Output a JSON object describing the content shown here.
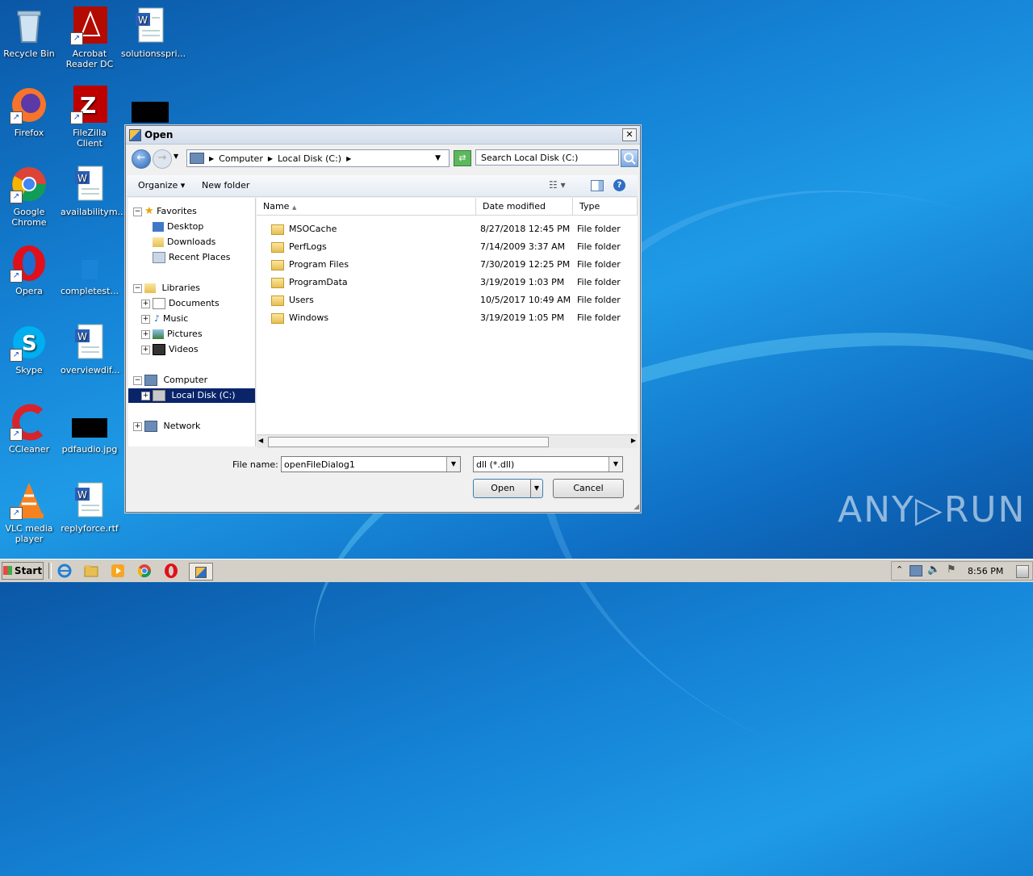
{
  "desktop": {
    "icons": [
      {
        "label": "Recycle Bin"
      },
      {
        "label": "Acrobat Reader DC"
      },
      {
        "label": "solutionsspri..."
      },
      {
        "label": "Firefox"
      },
      {
        "label": "FileZilla Client"
      },
      {
        "label": "Google Chrome"
      },
      {
        "label": "availabilitym..."
      },
      {
        "label": "Opera"
      },
      {
        "label": "completest..."
      },
      {
        "label": "Skype"
      },
      {
        "label": "overviewdif..."
      },
      {
        "label": "CCleaner"
      },
      {
        "label": "pdfaudio.jpg"
      },
      {
        "label": "VLC media player"
      },
      {
        "label": "replyforce.rtf"
      }
    ]
  },
  "dialog": {
    "title": "Open",
    "breadcrumb": [
      "Computer",
      "Local Disk (C:)"
    ],
    "search_placeholder": "Search Local Disk (C:)",
    "toolbar": {
      "organize": "Organize",
      "new_folder": "New folder"
    },
    "nav": {
      "favorites": "Favorites",
      "desktop": "Desktop",
      "downloads": "Downloads",
      "recent": "Recent Places",
      "libraries": "Libraries",
      "documents": "Documents",
      "music": "Music",
      "pictures": "Pictures",
      "videos": "Videos",
      "computer": "Computer",
      "local_disk": "Local Disk (C:)",
      "network": "Network"
    },
    "columns": {
      "name": "Name",
      "date": "Date modified",
      "type": "Type"
    },
    "files": [
      {
        "name": "MSOCache",
        "date": "8/27/2018 12:45 PM",
        "type": "File folder"
      },
      {
        "name": "PerfLogs",
        "date": "7/14/2009 3:37 AM",
        "type": "File folder"
      },
      {
        "name": "Program Files",
        "date": "7/30/2019 12:25 PM",
        "type": "File folder"
      },
      {
        "name": "ProgramData",
        "date": "3/19/2019 1:03 PM",
        "type": "File folder"
      },
      {
        "name": "Users",
        "date": "10/5/2017 10:49 AM",
        "type": "File folder"
      },
      {
        "name": "Windows",
        "date": "3/19/2019 1:05 PM",
        "type": "File folder"
      }
    ],
    "filename_label": "File name:",
    "filename_value": "openFileDialog1",
    "filter_value": "dll (*.dll)",
    "open_label": "Open",
    "cancel_label": "Cancel"
  },
  "taskbar": {
    "start_label": "Start",
    "clock": "8:56 PM"
  },
  "watermark": "ANY▷RUN"
}
